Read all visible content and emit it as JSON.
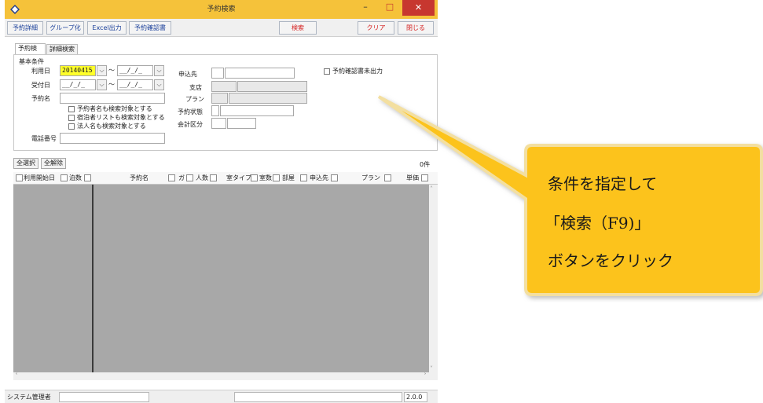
{
  "window": {
    "title": "予約検索",
    "minimize": "–",
    "maximize": "□",
    "close": "✕"
  },
  "toolbar": {
    "detail": "予約詳細",
    "group": "グループ化",
    "excel": "Excel出力",
    "confirm": "予約確認書",
    "search": "検索",
    "clear": "クリア",
    "close": "閉じる"
  },
  "tabs": [
    "予約検索",
    "詳細検索"
  ],
  "conditions": {
    "group_label": "基本条件",
    "use_date_label": "利用日",
    "use_date_from": "20140415",
    "use_date_to": "__/_/_",
    "tilde": "～",
    "recv_date_label": "受付日",
    "recv_date_from": "__/_/_",
    "recv_date_to": "__/_/_",
    "name_label": "予約名",
    "chk_applicant": "予約者名も検索対象とする",
    "chk_guest": "宿泊者リストも検索対象とする",
    "chk_corp": "法人名も検索対象とする",
    "phone_label": "電話番号",
    "applicant_label": "申込先",
    "branch_label": "支店",
    "plan_label": "プラン",
    "status_label": "予約状態",
    "account_label": "会計区分",
    "unprinted_label": "予約確認書未出力"
  },
  "list_actions": {
    "select_all": "全選択",
    "deselect_all": "全解除",
    "count": "0件"
  },
  "grid": {
    "columns": [
      "利用開始日",
      "泊数",
      "予約名",
      "ガ",
      "人数",
      "室タイプ",
      "室数",
      "部屋",
      "申込先",
      "プラン",
      "単価"
    ]
  },
  "status": {
    "user": "システム管理者",
    "version": "2.0.0"
  },
  "callout": {
    "lines": [
      "条件を指定して",
      "「検索（F9)」",
      "ボタンをクリック"
    ]
  },
  "colors": {
    "titlebar": "#f5c23a",
    "close": "#c7372f",
    "date_highlight": "#ffff2a",
    "grid_bg": "#a8a8a8",
    "callout_fill": "#fcc31a",
    "callout_border": "#f3dfa0"
  }
}
